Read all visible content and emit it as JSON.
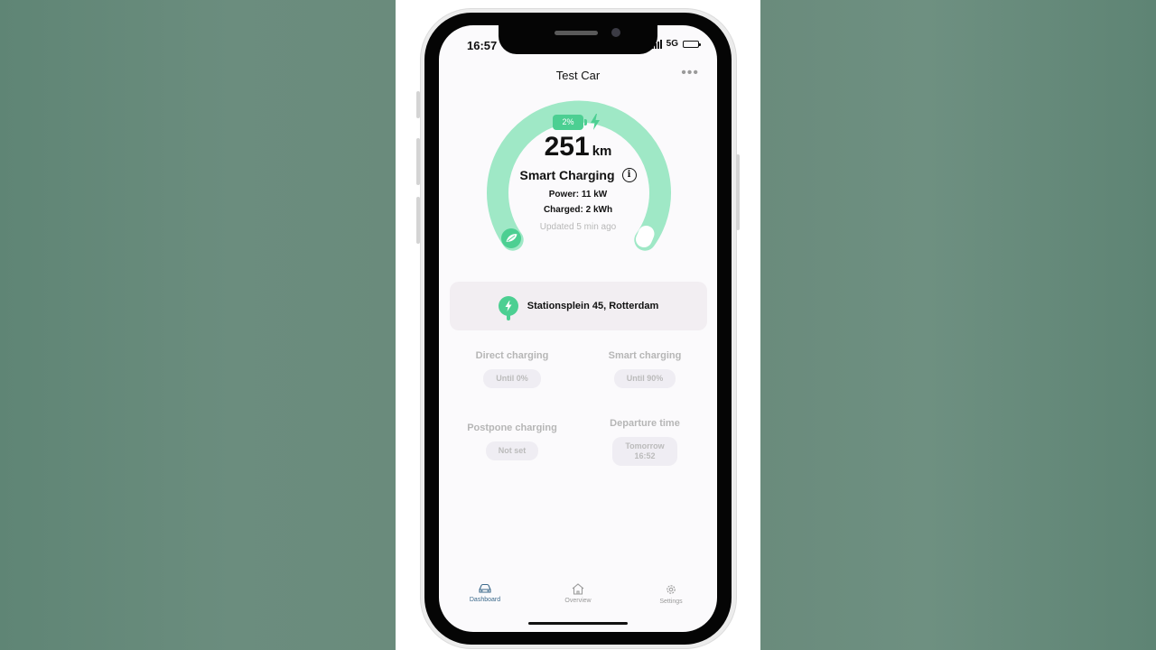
{
  "status_bar": {
    "time": "16:57",
    "network": "5G"
  },
  "header": {
    "title": "Test Car",
    "menu_icon": "more-horizontal-icon"
  },
  "gauge": {
    "battery_percent": "2%",
    "battery_level": 0.02,
    "range_value": "251",
    "range_unit": "km",
    "mode": "Smart Charging",
    "power": "Power: 11 kW",
    "charged": "Charged: 2 kWh",
    "updated": "Updated 5 min ago"
  },
  "location": {
    "address": "Stationsplein 45, Rotterdam",
    "icon": "charging-pin-icon"
  },
  "options": {
    "direct": {
      "label": "Direct charging",
      "value": "Until 0%"
    },
    "smart": {
      "label": "Smart charging",
      "value": "Until 90%"
    },
    "postpone": {
      "label": "Postpone charging",
      "value": "Not set"
    },
    "departure": {
      "label": "Departure time",
      "value_line1": "Tomorrow",
      "value_line2": "16:52"
    }
  },
  "tabbar": {
    "dashboard": "Dashboard",
    "overview": "Overview",
    "settings": "Settings"
  },
  "colors": {
    "accent": "#4ccf92",
    "gauge_track": "#9fe8c6",
    "active_tab": "#3e6b8c",
    "background_green": "#6a8b7c"
  }
}
